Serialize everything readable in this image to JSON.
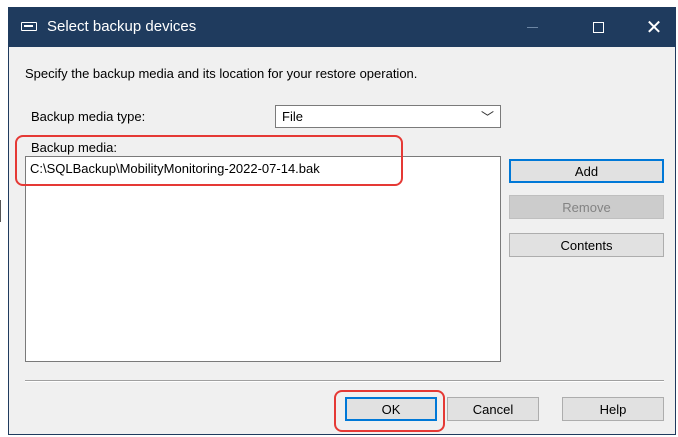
{
  "window": {
    "title": "Select backup devices"
  },
  "description": "Specify the backup media and its location for your restore operation.",
  "media_type": {
    "label": "Backup media type:",
    "value": "File"
  },
  "media_list": {
    "label": "Backup media:",
    "items": [
      "C:\\SQLBackup\\MobilityMonitoring-2022-07-14.bak"
    ]
  },
  "side_buttons": {
    "add": "Add",
    "remove": "Remove",
    "contents": "Contents"
  },
  "footer_buttons": {
    "ok": "OK",
    "cancel": "Cancel",
    "help": "Help"
  },
  "colors": {
    "titlebar": "#1f3b5e",
    "highlight": "#e53935",
    "focus": "#0078d7"
  }
}
